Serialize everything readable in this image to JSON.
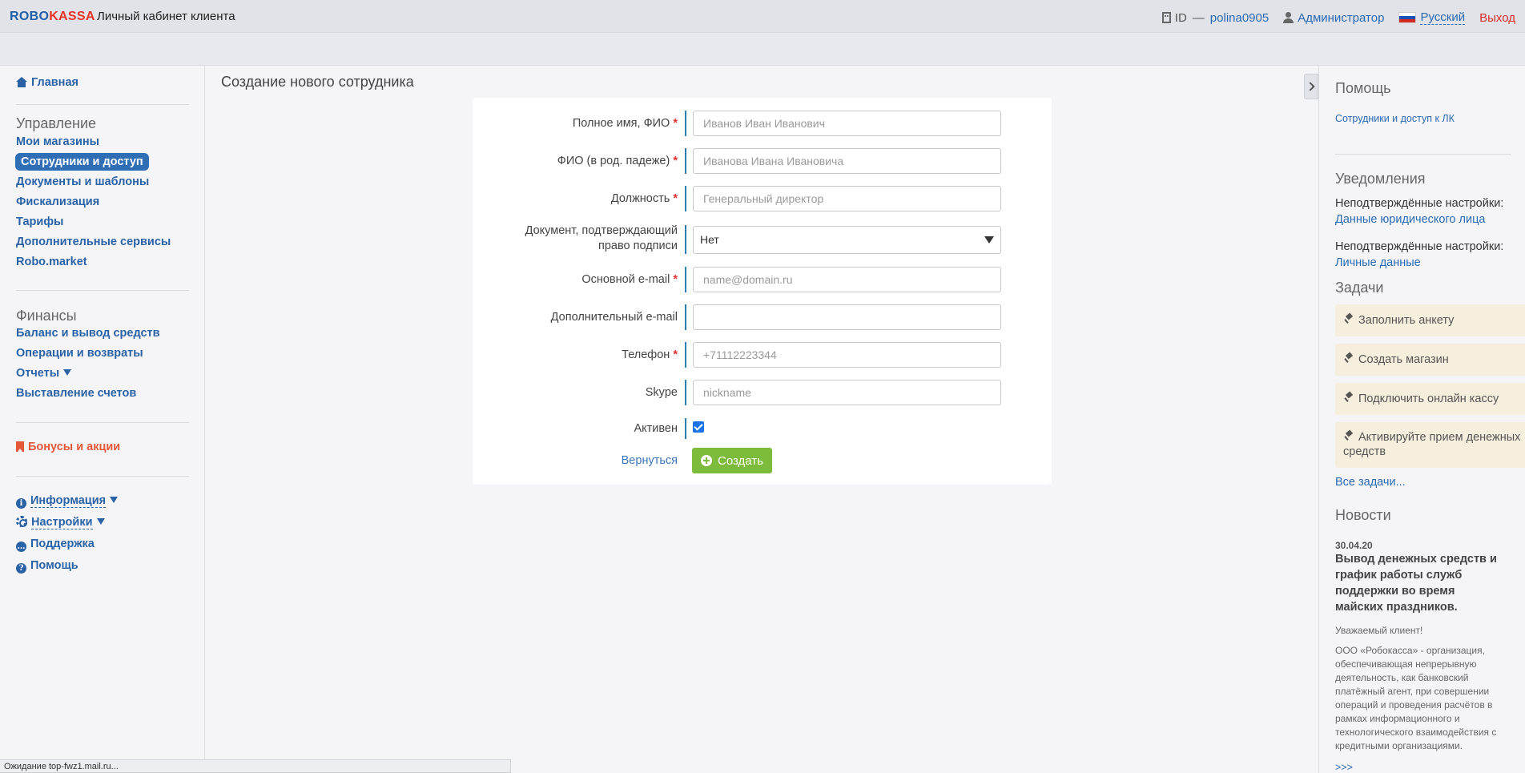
{
  "header": {
    "brand_robo": "ROBO",
    "brand_kassa": "KASSA",
    "cabinet": "Личный кабинет клиента",
    "id_label": "ID",
    "id_dash": "—",
    "username": "polina0905",
    "role": "Администратор",
    "language": "Русский",
    "logout": "Выход"
  },
  "sidebar": {
    "home": "Главная",
    "management_head": "Управление",
    "management": [
      "Мои магазины",
      "Сотрудники и доступ",
      "Документы и шаблоны",
      "Фискализация",
      "Тарифы",
      "Дополнительные сервисы",
      "Robo.market"
    ],
    "finance_head": "Финансы",
    "finance": [
      "Баланс и вывод средств",
      "Операции и возвраты",
      "Отчеты",
      "Выставление счетов"
    ],
    "bonus": "Бонусы и акции",
    "info": "Информация",
    "settings": "Настройки",
    "support": "Поддержка",
    "help": "Помощь"
  },
  "main": {
    "title": "Создание нового сотрудника",
    "form": {
      "full_name": {
        "label": "Полное имя, ФИО",
        "placeholder": "Иванов Иван Иванович",
        "value": ""
      },
      "genitive_name": {
        "label": "ФИО (в род. падеже)",
        "placeholder": "Иванова Ивана Ивановича",
        "value": ""
      },
      "position": {
        "label": "Должность",
        "placeholder": "Генеральный директор",
        "value": ""
      },
      "document": {
        "label_line1": "Документ, подтверждающий",
        "label_line2": "право подписи",
        "selected": "Нет"
      },
      "email": {
        "label": "Основной e-mail",
        "placeholder": "name@domain.ru",
        "value": ""
      },
      "extra_email": {
        "label": "Дополнительный e-mail",
        "placeholder": "",
        "value": ""
      },
      "phone": {
        "label": "Телефон",
        "placeholder": "+71112223344",
        "value": ""
      },
      "skype": {
        "label": "Skype",
        "placeholder": "nickname",
        "value": ""
      },
      "active": {
        "label": "Активен",
        "checked": true
      },
      "required_mark": "*",
      "back": "Вернуться",
      "submit": "Создать"
    }
  },
  "rightpanel": {
    "help_head": "Помощь",
    "help_link": "Сотрудники и доступ к ЛК",
    "notifications_head": "Уведомления",
    "notice1_text": "Неподтверждённые настройки:",
    "notice1_link": "Данные юридического лица",
    "notice2_text": "Неподтверждённые настройки:",
    "notice2_link": "Личные данные",
    "tasks_head": "Задачи",
    "tasks": [
      "Заполнить анкету",
      "Создать магазин",
      "Подключить онлайн кассу"
    ],
    "task4_line1": "Активируйте прием денежных",
    "task4_line2": "средств",
    "all_tasks": "Все задачи...",
    "news_head": "Новости",
    "news_date": "30.04.20",
    "news_title": "Вывод денежных средств и график работы служб поддержки во время майских праздников.",
    "news_greeting": "Уважаемый клиент!",
    "news_body": "ООО «Робокасса» - организация, обеспечивающая непрерывную деятельность, как банковский платёжный агент, при совершении операций и проведения расчётов в рамках информационного и технологического взаимодействия с кредитными организациями.",
    "news_more": ">>>"
  },
  "statusbar": "Ожидание top-fwz1.mail.ru...",
  "colors": {
    "accent": "#2f6db5",
    "create_button": "#7dbb3c",
    "bonus": "#e4583a",
    "required": "#e23030"
  }
}
